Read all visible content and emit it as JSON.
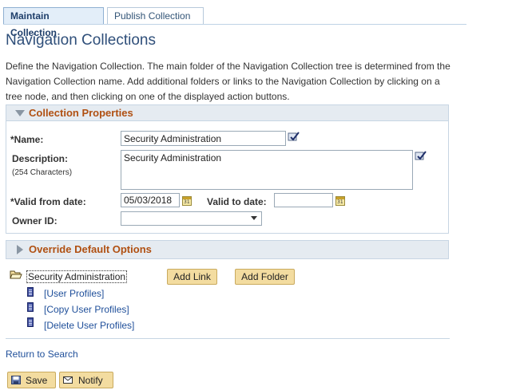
{
  "tabs": [
    {
      "label": "Maintain Collection",
      "active": true
    },
    {
      "label": "Publish Collection",
      "active": false
    }
  ],
  "page": {
    "title": "Navigation Collections",
    "description": "Define the Navigation Collection. The main folder of the Navigation Collection tree is determined from the Navigation Collection name. Add additional folders or links to the Navigation Collection by clicking on a tree node, and then clicking on one of the displayed action buttons."
  },
  "collection_properties": {
    "title": "Collection Properties",
    "name_label": "*Name:",
    "name_value": "Security Administration",
    "description_label": "Description:",
    "description_hint": "(254 Characters)",
    "description_value": "Security Administration",
    "valid_from_label": "*Valid from date:",
    "valid_from_value": "05/03/2018",
    "valid_to_label": "Valid to date:",
    "valid_to_value": "",
    "owner_label": "Owner ID:",
    "owner_value": "",
    "calendar_glyph": "31"
  },
  "override": {
    "title": "Override Default Options"
  },
  "tree": {
    "root": "Security Administration",
    "items": [
      "[User Profiles]",
      "[Copy User Profiles]",
      "[Delete User Profiles]"
    ],
    "add_link_label": "Add Link",
    "add_folder_label": "Add Folder"
  },
  "return_link": "Return to Search",
  "toolbar": {
    "save_label": "Save",
    "notify_label": "Notify"
  },
  "colors": {
    "title_blue": "#2f4f7a",
    "group_title_orange": "#b05012",
    "button_gold": "#f3dca0",
    "link_blue": "#1f4f9a"
  }
}
